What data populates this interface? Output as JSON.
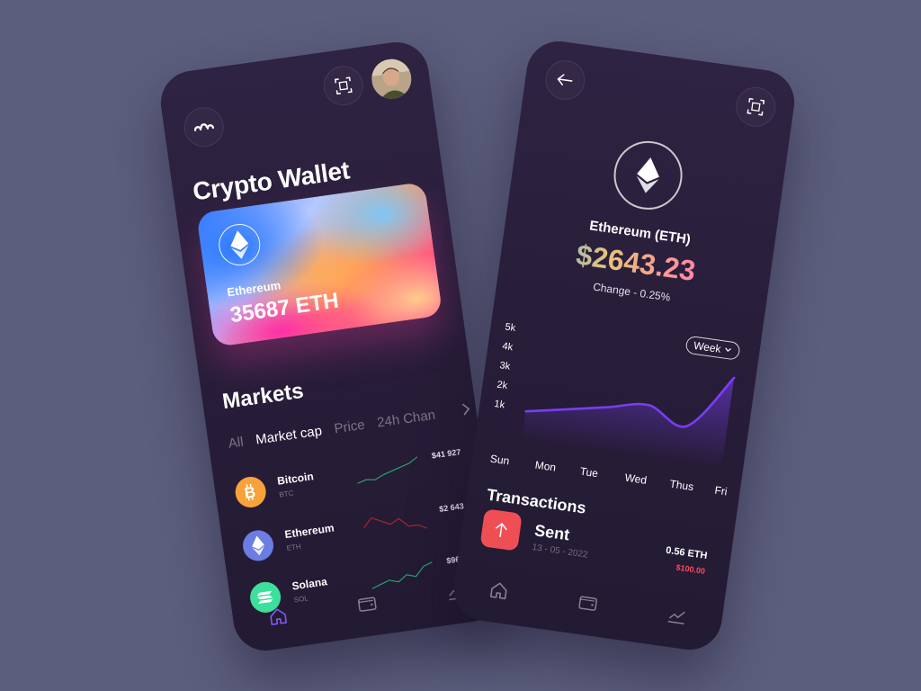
{
  "wallet_screen": {
    "menu_icon": "menu-dots-icon",
    "scan_icon": "scan-icon",
    "avatar_icon": "user-avatar",
    "title": "Crypto Wallet",
    "card": {
      "coin_icon": "ethereum-icon",
      "coin_name": "Ethereum",
      "balance": "35687 ETH"
    },
    "markets": {
      "title": "Markets",
      "filters": [
        "All",
        "Market cap",
        "Price",
        "24h Chan"
      ],
      "active_filter": "Market cap",
      "more_icon": "chevron-right-icon",
      "coins": [
        {
          "name": "Bitcoin",
          "symbol": "BTC",
          "price": "$41 927",
          "icon": "bitcoin-icon",
          "color": "#f7a23a",
          "trend_color": "#27a36a",
          "trend": [
            3,
            4,
            3.5,
            5,
            6,
            7,
            8,
            10
          ]
        },
        {
          "name": "Ethereum",
          "symbol": "ETH",
          "price": "$2 643",
          "icon": "ethereum-icon",
          "color": "#6b7de2",
          "trend_color": "#a6272f",
          "trend": [
            8,
            10,
            9,
            8,
            9,
            7,
            7,
            6
          ]
        },
        {
          "name": "Solana",
          "symbol": "SOL",
          "price": "$96",
          "icon": "solana-icon",
          "color": "#3cdf9b",
          "trend_color": "#27a36a",
          "trend": [
            3,
            4,
            5,
            4,
            6,
            5,
            8,
            9
          ]
        }
      ]
    },
    "nav": [
      "home-icon",
      "wallet-icon",
      "chart-icon"
    ],
    "active_nav": "home-icon"
  },
  "detail_screen": {
    "back_icon": "arrow-left-icon",
    "scan_icon": "scan-icon",
    "coin_icon": "ethereum-icon",
    "asset_name": "Ethereum (ETH)",
    "price": "$2643.23",
    "change": "Change - 0.25%",
    "period": "Week",
    "chart_data": {
      "type": "area",
      "categories": [
        "Sun",
        "Mon",
        "Tue",
        "Wed",
        "Thus",
        "Fri"
      ],
      "y_ticks": [
        "5k",
        "4k",
        "3k",
        "2k",
        "1k"
      ],
      "ylim": [
        0,
        5000
      ],
      "values": [
        800,
        1200,
        1600,
        2000,
        1200,
        4000
      ],
      "color": "#7a3df7"
    },
    "transactions": {
      "title": "Transactions",
      "items": [
        {
          "label": "Sent",
          "date": "13 - 05 - 2022",
          "amount": "0.56 ETH",
          "fiat": "$100.00",
          "icon": "arrow-up-icon"
        }
      ]
    },
    "nav": [
      "home-icon",
      "wallet-icon",
      "chart-icon"
    ]
  }
}
